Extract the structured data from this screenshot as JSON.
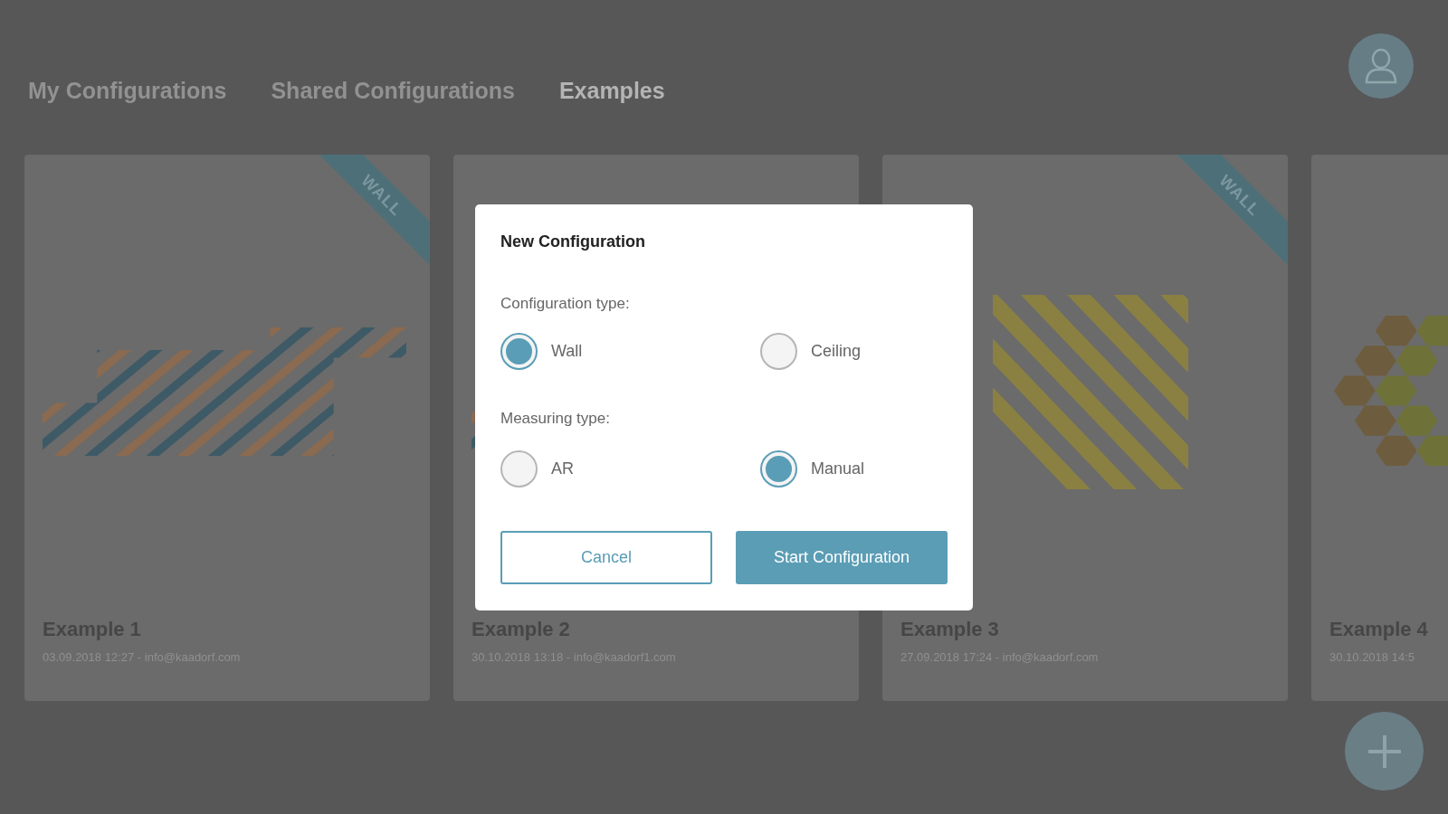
{
  "tabs": [
    {
      "label": "My Configurations",
      "selected": false
    },
    {
      "label": "Shared Configurations",
      "selected": false
    },
    {
      "label": "Examples",
      "selected": true
    }
  ],
  "cards": [
    {
      "title": "Example 1",
      "subtitle": "03.09.2018 12:27 - info@kaadorf.com",
      "ribbon": "WALL"
    },
    {
      "title": "Example 2",
      "subtitle": "30.10.2018 13:18 - info@kaadorf1.com"
    },
    {
      "title": "Example 3",
      "subtitle": "27.09.2018 17:24 - info@kaadorf.com",
      "ribbon": "WALL"
    },
    {
      "title": "Example 4",
      "subtitle": "30.10.2018 14:5"
    }
  ],
  "dialog": {
    "title": "New Configuration",
    "groups": [
      {
        "label": "Configuration type:",
        "options": [
          {
            "label": "Wall",
            "selected": true
          },
          {
            "label": "Ceiling",
            "selected": false
          }
        ]
      },
      {
        "label": "Measuring type:",
        "options": [
          {
            "label": "AR",
            "selected": false
          },
          {
            "label": "Manual",
            "selected": true
          }
        ]
      }
    ],
    "buttons": [
      {
        "label": "Cancel",
        "kind": "outline"
      },
      {
        "label": "Start Configuration",
        "kind": "primary"
      }
    ]
  }
}
